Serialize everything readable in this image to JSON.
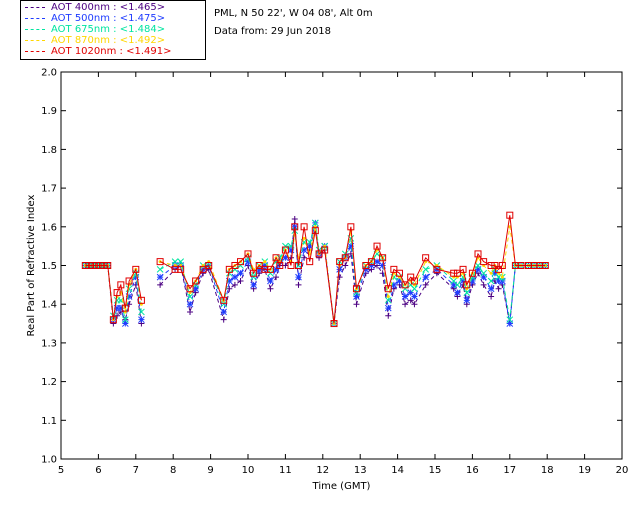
{
  "header": {
    "site": "PML, N 50 22', W 04 08', Alt 0m",
    "date": "Data from: 29 Jun 2018"
  },
  "legend": [
    {
      "label": "AOT  400nm : <1.465>",
      "color": "#4b0082"
    },
    {
      "label": "AOT  500nm : <1.475>",
      "color": "#1e3cff"
    },
    {
      "label": "AOT  675nm : <1.484>",
      "color": "#00e5a0"
    },
    {
      "label": "AOT  870nm : <1.492>",
      "color": "#ffd700"
    },
    {
      "label": "AOT 1020nm : <1.491>",
      "color": "#e00000"
    }
  ],
  "chart_data": {
    "type": "line",
    "title": "",
    "xlabel": "Time (GMT)",
    "ylabel": "Real Part of Refractive Index",
    "xlim": [
      5,
      20
    ],
    "ylim": [
      1.0,
      2.0
    ],
    "xticks": [
      "5",
      "6",
      "7",
      "8",
      "9",
      "10",
      "11",
      "12",
      "13",
      "14",
      "15",
      "16",
      "17",
      "18",
      "19",
      "20"
    ],
    "yticks": [
      "1.0",
      "1.1",
      "1.2",
      "1.3",
      "1.4",
      "1.5",
      "1.6",
      "1.7",
      "1.8",
      "1.9",
      "2.0"
    ],
    "x": [
      5.65,
      5.75,
      5.85,
      5.95,
      6.05,
      6.15,
      6.25,
      6.4,
      6.5,
      6.6,
      6.72,
      6.82,
      7.0,
      7.15,
      7.3,
      7.65,
      8.05,
      8.2,
      8.45,
      8.6,
      8.8,
      8.95,
      9.35,
      9.5,
      9.65,
      9.8,
      10.0,
      10.15,
      10.3,
      10.45,
      10.6,
      10.75,
      10.85,
      11.0,
      11.15,
      11.25,
      11.35,
      11.5,
      11.65,
      11.8,
      11.9,
      12.05,
      12.3,
      12.45,
      12.6,
      12.75,
      12.9,
      13.15,
      13.3,
      13.45,
      13.6,
      13.75,
      13.9,
      14.05,
      14.2,
      14.35,
      14.45,
      14.75,
      15.05,
      15.5,
      15.6,
      15.75,
      15.85,
      16.0,
      16.15,
      16.3,
      16.5,
      16.6,
      16.7,
      16.8,
      17.0,
      17.15,
      17.3,
      17.5,
      17.65,
      17.8,
      17.95
    ],
    "series": [
      {
        "name": "AOT  400nm : <1.465>",
        "values": [
          1.5,
          1.5,
          1.5,
          1.5,
          1.5,
          1.5,
          1.5,
          1.35,
          1.37,
          1.38,
          1.36,
          1.4,
          1.45,
          1.35,
          null,
          1.45,
          1.49,
          1.5,
          1.38,
          1.43,
          1.48,
          1.49,
          1.36,
          1.44,
          1.45,
          1.46,
          1.5,
          1.44,
          1.48,
          1.49,
          1.44,
          1.47,
          1.5,
          1.5,
          1.52,
          1.62,
          1.45,
          1.52,
          1.54,
          1.6,
          1.52,
          1.54,
          1.35,
          1.47,
          1.5,
          1.53,
          1.4,
          1.48,
          1.49,
          1.5,
          1.48,
          1.37,
          1.44,
          1.45,
          1.4,
          1.41,
          1.4,
          1.45,
          1.48,
          1.44,
          1.42,
          1.45,
          1.4,
          1.45,
          1.48,
          1.45,
          1.42,
          1.46,
          1.44,
          1.45,
          1.35,
          1.5,
          1.5,
          1.5,
          1.5,
          1.5,
          1.5
        ]
      },
      {
        "name": "AOT  500nm : <1.475>",
        "values": [
          1.5,
          1.5,
          1.5,
          1.5,
          1.5,
          1.5,
          1.5,
          1.36,
          1.39,
          1.39,
          1.35,
          1.42,
          1.47,
          1.36,
          null,
          1.47,
          1.5,
          1.5,
          1.4,
          1.44,
          1.49,
          1.5,
          1.38,
          1.46,
          1.47,
          1.48,
          1.51,
          1.45,
          1.49,
          1.5,
          1.46,
          1.49,
          1.51,
          1.52,
          1.54,
          1.6,
          1.47,
          1.54,
          1.55,
          1.61,
          1.53,
          1.55,
          1.35,
          1.49,
          1.52,
          1.55,
          1.42,
          1.49,
          1.5,
          1.51,
          1.5,
          1.39,
          1.45,
          1.46,
          1.42,
          1.43,
          1.42,
          1.47,
          1.49,
          1.45,
          1.43,
          1.46,
          1.41,
          1.46,
          1.49,
          1.47,
          1.44,
          1.48,
          1.46,
          1.46,
          1.35,
          1.5,
          1.5,
          1.5,
          1.5,
          1.5,
          1.5
        ]
      },
      {
        "name": "AOT  675nm : <1.484>",
        "values": [
          1.5,
          1.5,
          1.5,
          1.5,
          1.5,
          1.5,
          1.5,
          1.37,
          1.41,
          1.41,
          1.36,
          1.44,
          1.48,
          1.38,
          null,
          1.49,
          1.51,
          1.51,
          1.42,
          1.45,
          1.5,
          1.5,
          1.4,
          1.48,
          1.49,
          1.5,
          1.52,
          1.47,
          1.5,
          1.51,
          1.48,
          1.51,
          1.52,
          1.55,
          1.55,
          1.59,
          1.5,
          1.56,
          1.56,
          1.61,
          1.54,
          1.55,
          1.35,
          1.51,
          1.53,
          1.57,
          1.43,
          1.5,
          1.51,
          1.53,
          1.52,
          1.41,
          1.47,
          1.47,
          1.44,
          1.45,
          1.44,
          1.49,
          1.5,
          1.46,
          1.45,
          1.47,
          1.43,
          1.47,
          1.5,
          1.48,
          1.46,
          1.49,
          1.47,
          1.47,
          1.36,
          1.5,
          1.5,
          1.5,
          1.5,
          1.5,
          1.5
        ]
      },
      {
        "name": "AOT  870nm : <1.492>",
        "values": [
          1.5,
          1.5,
          1.5,
          1.5,
          1.5,
          1.5,
          1.5,
          1.36,
          1.42,
          1.43,
          1.38,
          1.45,
          1.49,
          1.4,
          null,
          1.51,
          1.5,
          1.5,
          1.43,
          1.46,
          1.5,
          1.51,
          1.41,
          1.49,
          1.5,
          1.51,
          1.53,
          1.49,
          1.5,
          1.51,
          1.49,
          1.52,
          1.51,
          1.54,
          1.51,
          1.58,
          1.52,
          1.57,
          1.53,
          1.6,
          1.53,
          1.55,
          1.35,
          1.5,
          1.52,
          1.59,
          1.44,
          1.5,
          1.51,
          1.54,
          1.52,
          1.42,
          1.48,
          1.47,
          1.45,
          1.46,
          1.45,
          1.51,
          1.5,
          1.47,
          1.47,
          1.48,
          1.44,
          1.48,
          1.52,
          1.5,
          1.48,
          1.5,
          1.48,
          1.47,
          1.6,
          1.5,
          1.5,
          1.5,
          1.5,
          1.5,
          1.5
        ]
      },
      {
        "name": "AOT 1020nm : <1.491>",
        "values": [
          1.5,
          1.5,
          1.5,
          1.5,
          1.5,
          1.5,
          1.5,
          1.36,
          1.43,
          1.45,
          1.39,
          1.46,
          1.49,
          1.41,
          null,
          1.51,
          1.49,
          1.49,
          1.44,
          1.46,
          1.49,
          1.5,
          1.41,
          1.49,
          1.5,
          1.51,
          1.53,
          1.48,
          1.5,
          1.49,
          1.49,
          1.52,
          1.5,
          1.54,
          1.5,
          1.6,
          1.5,
          1.6,
          1.51,
          1.59,
          1.53,
          1.54,
          1.35,
          1.51,
          1.52,
          1.6,
          1.44,
          1.5,
          1.51,
          1.55,
          1.52,
          1.44,
          1.49,
          1.48,
          1.45,
          1.47,
          1.46,
          1.52,
          1.49,
          1.48,
          1.48,
          1.49,
          1.45,
          1.48,
          1.53,
          1.51,
          1.5,
          1.5,
          1.49,
          1.5,
          1.63,
          1.5,
          1.5,
          1.5,
          1.5,
          1.5,
          1.5
        ]
      }
    ]
  }
}
